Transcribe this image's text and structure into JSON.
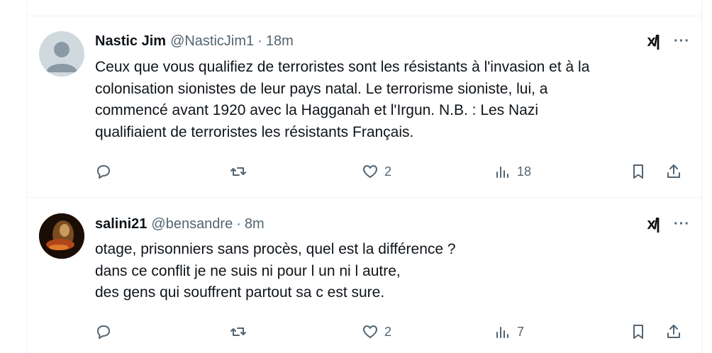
{
  "tweets": [
    {
      "name": "Nastic Jim",
      "handle": "@NasticJim1",
      "separator": "·",
      "time": "18m",
      "text": "Ceux que vous qualifiez de terroristes sont les résistants à l'invasion et à la\ncolonisation sionistes de leur pays natal. Le terrorisme sioniste, lui, a\ncommencé avant 1920 avec la Hagganah et l'Irgun. N.B. : Les Nazi\nqualifiaient de terroristes les résistants Français.",
      "likes": "2",
      "views": "18",
      "avatar_icon": "default-avatar-icon"
    },
    {
      "name": "salini21",
      "handle": "@bensandre",
      "separator": "·",
      "time": "8m",
      "text": "otage, prisonniers sans procès, quel est la différence ?\ndans ce conflit je ne suis ni pour l un ni l autre,\ndes gens qui souffrent partout sa c est sure.",
      "likes": "2",
      "views": "7",
      "avatar_icon": "photo-avatar"
    }
  ],
  "icons": {
    "grok": "xl-glyph",
    "more": "···",
    "reply": "reply-icon",
    "repost": "repost-icon",
    "like": "heart-icon",
    "views": "views-icon",
    "bookmark": "bookmark-icon",
    "share": "share-icon"
  },
  "icon_glyphs": {
    "grok_text": "x/|",
    "more_text": "···"
  },
  "colors": {
    "text": "#0f1419",
    "secondary": "#536471",
    "border": "#eff3f4",
    "avatar_default": "#cfd9de"
  }
}
